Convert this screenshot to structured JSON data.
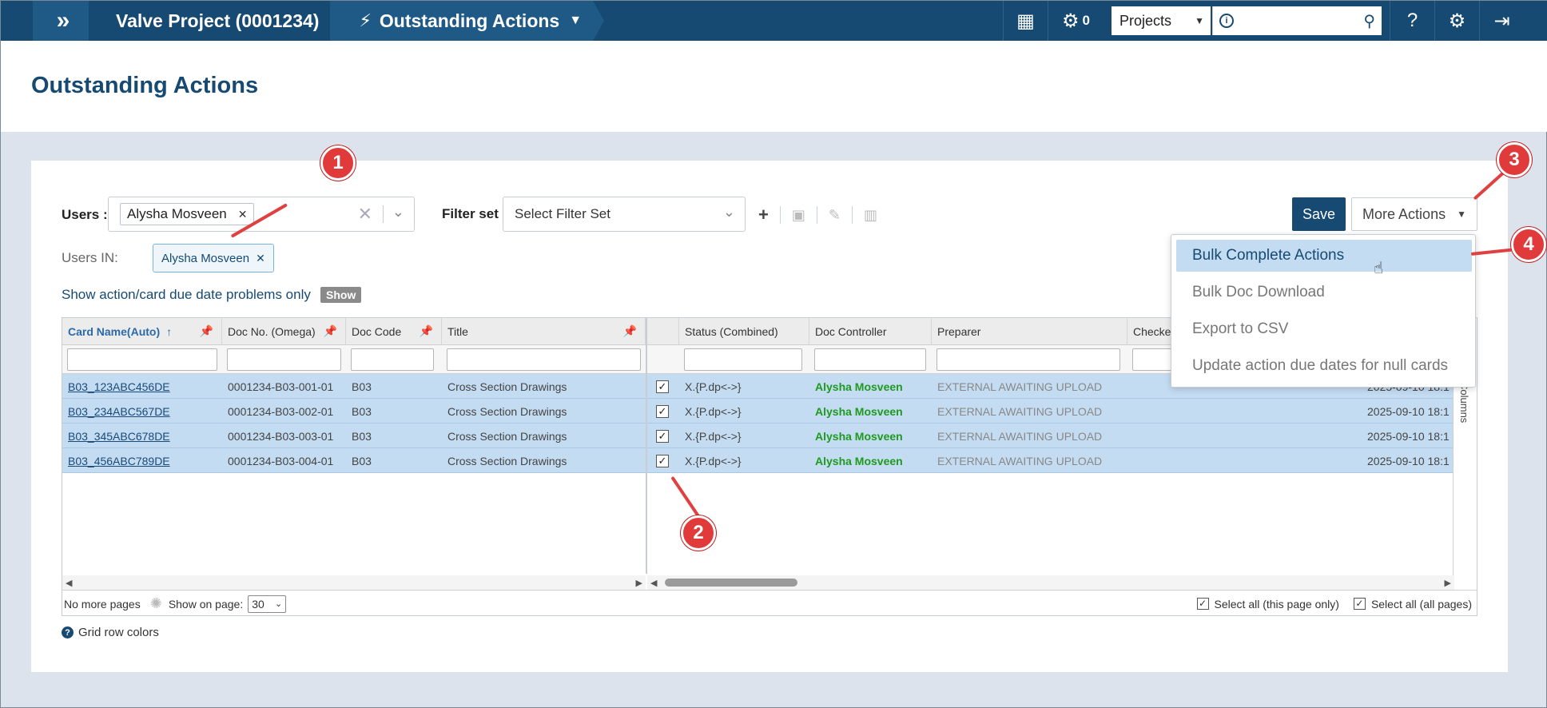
{
  "topbar": {
    "project": "Valve Project (0001234)",
    "section": "Outstanding Actions",
    "jobs_count": "0",
    "scope_select": "Projects"
  },
  "page": {
    "title": "Outstanding Actions"
  },
  "filters": {
    "users_label": "Users :",
    "selected_user": "Alysha Mosveen",
    "filter_set_label": "Filter set",
    "filter_set_placeholder": "Select Filter Set",
    "users_in_label": "Users IN:",
    "users_in_chip": "Alysha Mosveen",
    "due_problems_text": "Show action/card due date problems only",
    "show_badge": "Show"
  },
  "actions": {
    "save": "Save",
    "more": "More Actions",
    "menu": [
      "Bulk Complete Actions",
      "Bulk Doc Download",
      "Export to CSV",
      "Update action due dates for null cards"
    ]
  },
  "grid": {
    "columns": [
      "Card Name(Auto)",
      "Doc No. (Omega)",
      "Doc Code",
      "Title",
      "",
      "Status (Combined)",
      "Doc Controller",
      "Preparer",
      "Checker"
    ],
    "side_label": "Columns",
    "rows": [
      [
        "B03_123ABC456DE",
        "0001234-B03-001-01",
        "B03",
        "Cross Section Drawings",
        "X.{P.dp<->}",
        "Alysha Mosveen",
        "EXTERNAL AWAITING UPLOAD",
        "2025-09-10 18:1"
      ],
      [
        "B03_234ABC567DE",
        "0001234-B03-002-01",
        "B03",
        "Cross Section Drawings",
        "X.{P.dp<->}",
        "Alysha Mosveen",
        "EXTERNAL AWAITING UPLOAD",
        "2025-09-10 18:1"
      ],
      [
        "B03_345ABC678DE",
        "0001234-B03-003-01",
        "B03",
        "Cross Section Drawings",
        "X.{P.dp<->}",
        "Alysha Mosveen",
        "EXTERNAL AWAITING UPLOAD",
        "2025-09-10 18:1"
      ],
      [
        "B03_456ABC789DE",
        "0001234-B03-004-01",
        "B03",
        "Cross Section Drawings",
        "X.{P.dp<->}",
        "Alysha Mosveen",
        "EXTERNAL AWAITING UPLOAD",
        "2025-09-10 18:1"
      ]
    ],
    "footer": {
      "no_more_pages": "No more pages",
      "show_on_page": "Show on page:",
      "page_size": "30",
      "select_page": "Select all (this page only)",
      "select_all": "Select all (all pages)"
    }
  },
  "grid_row_colors": "Grid row colors",
  "annotations": [
    "1",
    "2",
    "3",
    "4"
  ],
  "colors": {
    "brand": "#174a72",
    "accent": "#e03a3a",
    "row_selected": "#c4dcf2"
  }
}
